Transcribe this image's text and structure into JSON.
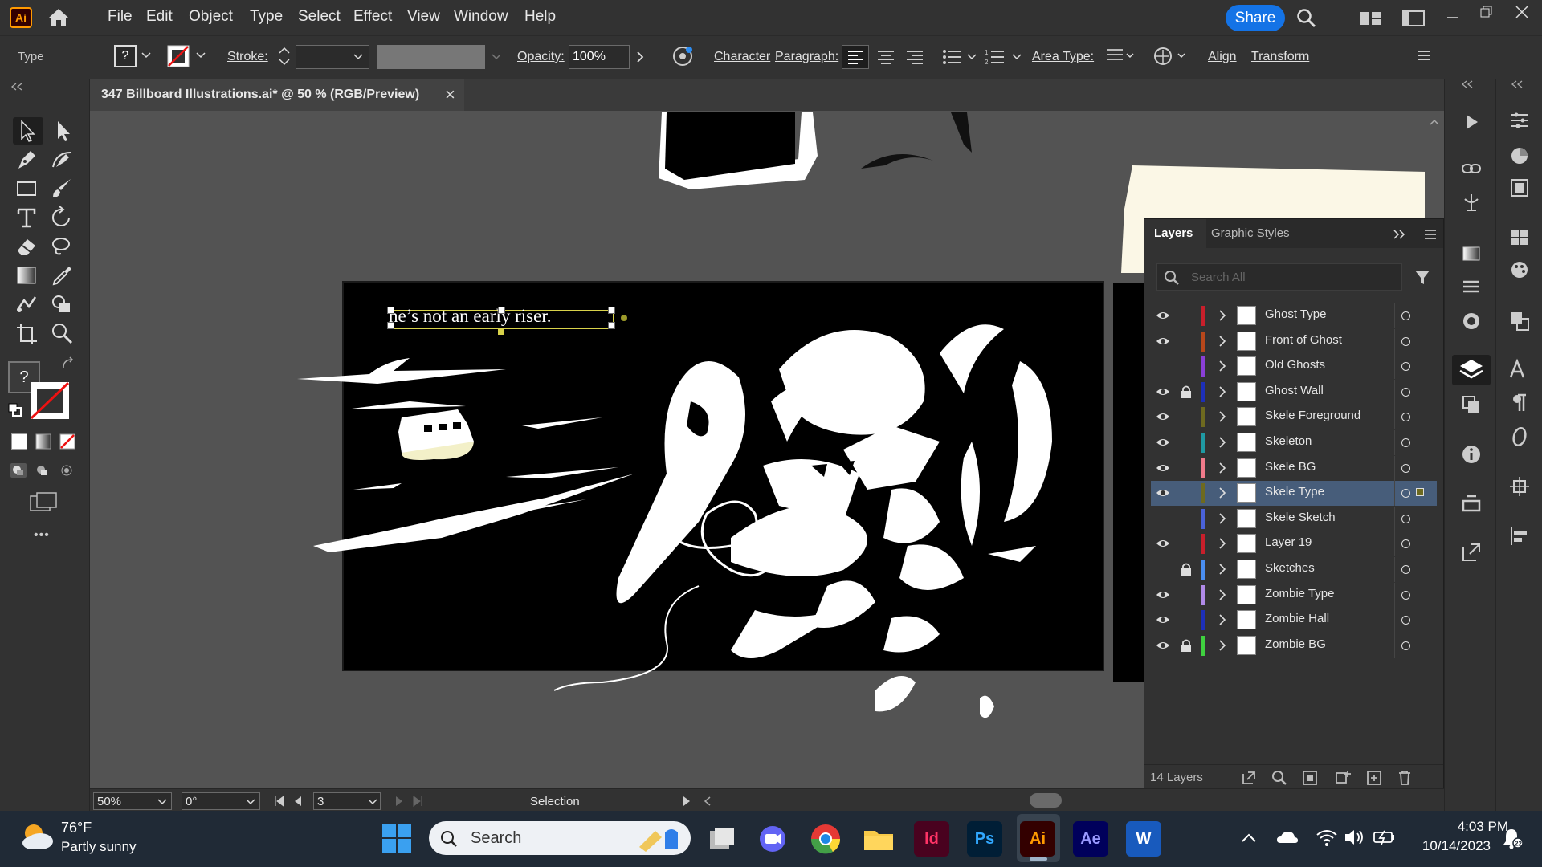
{
  "app": {
    "logo": "Ai",
    "menu": [
      "File",
      "Edit",
      "Object",
      "Type",
      "Select",
      "Effect",
      "View",
      "Window",
      "Help"
    ],
    "share_label": "Share"
  },
  "control_bar": {
    "tool_name": "Type",
    "fill_value": "?",
    "stroke_label": "Stroke:",
    "opacity_label": "Opacity:",
    "opacity_value": "100%",
    "character_label": "Character",
    "paragraph_label": "Paragraph:",
    "area_type_label": "Area Type:",
    "align_label": "Align",
    "transform_label": "Transform"
  },
  "document": {
    "tab_title": "347 Billboard Illustrations.ai* @ 50 % (RGB/Preview)",
    "close_glyph": "×",
    "artboard_text": "he’s not an early riser."
  },
  "left_tools": {
    "fill_stroke_value": "?",
    "more_glyph": "•••"
  },
  "layers_panel": {
    "tabs": [
      "Layers",
      "Graphic Styles"
    ],
    "search_placeholder": "Search All",
    "layers": [
      {
        "name": "Ghost Type",
        "visible": true,
        "locked": false,
        "color": "#c81f2b",
        "selected": false
      },
      {
        "name": "Front of Ghost",
        "visible": true,
        "locked": false,
        "color": "#b7471b",
        "selected": false
      },
      {
        "name": "Old Ghosts",
        "visible": false,
        "locked": false,
        "color": "#8a3fd6",
        "selected": false
      },
      {
        "name": "Ghost Wall",
        "visible": true,
        "locked": true,
        "color": "#1d2fb8",
        "selected": false
      },
      {
        "name": "Skele Foreground",
        "visible": true,
        "locked": false,
        "color": "#6e6a1f",
        "selected": false
      },
      {
        "name": "Skeleton",
        "visible": true,
        "locked": false,
        "color": "#1f9aa3",
        "selected": false
      },
      {
        "name": "Skele BG",
        "visible": true,
        "locked": false,
        "color": "#f07a8a",
        "selected": false
      },
      {
        "name": "Skele Type",
        "visible": true,
        "locked": false,
        "color": "#6e6a1f",
        "selected": true
      },
      {
        "name": "Skele Sketch",
        "visible": false,
        "locked": false,
        "color": "#4a62d9",
        "selected": false
      },
      {
        "name": "Layer 19",
        "visible": true,
        "locked": false,
        "color": "#c81f2b",
        "selected": false
      },
      {
        "name": "Sketches",
        "visible": false,
        "locked": true,
        "color": "#4a8ef0",
        "selected": false
      },
      {
        "name": "Zombie Type",
        "visible": true,
        "locked": false,
        "color": "#b08ae8",
        "selected": false
      },
      {
        "name": "Zombie Hall",
        "visible": true,
        "locked": false,
        "color": "#1d2fb8",
        "selected": false
      },
      {
        "name": "Zombie BG",
        "visible": true,
        "locked": true,
        "color": "#3fd13f",
        "selected": false
      }
    ],
    "footer_count": "14 Layers"
  },
  "status_bar": {
    "zoom": "50%",
    "rotation": "0°",
    "artboard_number": "3",
    "tool_status": "Selection"
  },
  "taskbar": {
    "weather_temp": "76°F",
    "weather_desc": "Partly sunny",
    "search_label": "Search",
    "apps": [
      "Id",
      "Ps",
      "Ai",
      "Ae",
      "W"
    ],
    "time": "4:03 PM",
    "date": "10/14/2023"
  }
}
